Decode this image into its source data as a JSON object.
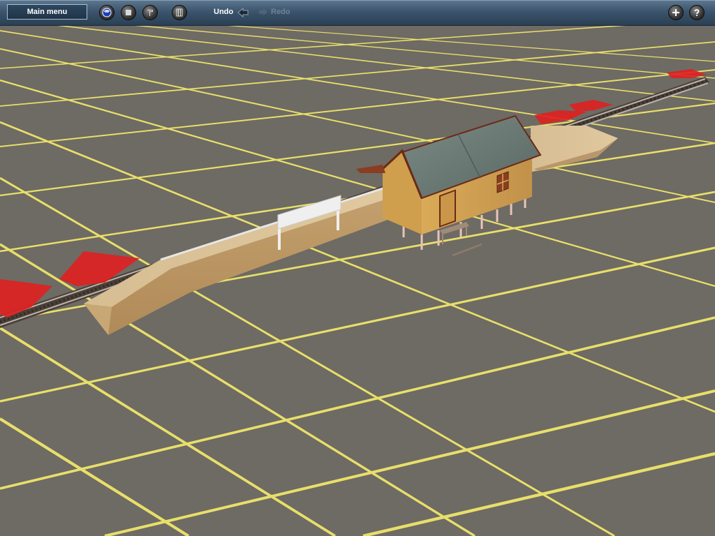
{
  "toolbar": {
    "main_menu_label": "Main menu",
    "undo_label": "Undo",
    "redo_label": "Redo",
    "tools": [
      {
        "icon": "globe-icon"
      },
      {
        "icon": "stop-icon"
      },
      {
        "icon": "paint-icon"
      },
      {
        "icon": "grid-icon"
      }
    ],
    "right_tools": [
      {
        "icon": "add-icon"
      },
      {
        "icon": "help-icon"
      }
    ]
  },
  "viewport": {
    "ground_color": "#6e6a64",
    "grid_color": "#e8df6a",
    "platform_color": "#c9a97a",
    "marker_color": "#e02020",
    "station_roof_color": "#6f7f7a",
    "station_wall_color": "#d6a653"
  }
}
